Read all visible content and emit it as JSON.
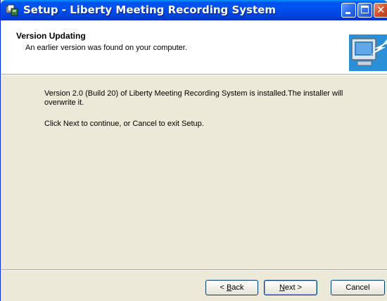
{
  "window": {
    "title": "Setup - Liberty Meeting Recording System"
  },
  "header": {
    "title": "Version Updating",
    "subtitle": "An earlier version was found on your computer."
  },
  "body": {
    "line1": "Version 2.0 (Build 20) of Liberty Meeting Recording System is installed.The installer will overwrite it.",
    "line2": "Click Next to continue, or Cancel to exit Setup."
  },
  "buttons": {
    "back_prefix": "< ",
    "back_accel": "B",
    "back_rest": "ack",
    "next_accel": "N",
    "next_rest": "ext >",
    "cancel": "Cancel"
  },
  "icons": {
    "app": "setup-app-icon",
    "wizard": "computer-install-icon"
  },
  "colors": {
    "titlebar": "#0053ee",
    "dialog_bg": "#ece9d8",
    "close_button": "#d4502b"
  }
}
